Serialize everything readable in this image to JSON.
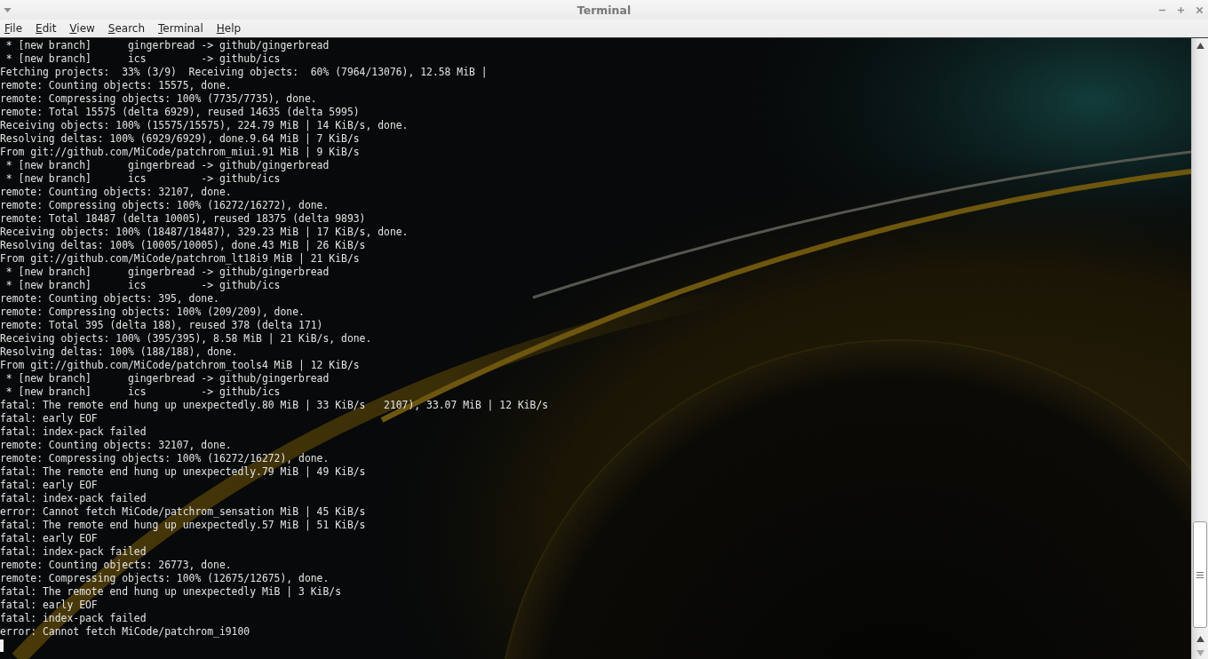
{
  "window": {
    "title": "Terminal"
  },
  "menu_bar": [
    "File",
    "Edit",
    "View",
    "Search",
    "Terminal",
    "Help"
  ],
  "terminal": {
    "lines": [
      " * [new branch]      gingerbread -> github/gingerbread",
      " * [new branch]      ics         -> github/ics",
      "Fetching projects:  33% (3/9)  Receiving objects:  60% (7964/13076), 12.58 MiB |",
      "remote: Counting objects: 15575, done.",
      "remote: Compressing objects: 100% (7735/7735), done.",
      "remote: Total 15575 (delta 6929), reused 14635 (delta 5995)",
      "Receiving objects: 100% (15575/15575), 224.79 MiB | 14 KiB/s, done.",
      "Resolving deltas: 100% (6929/6929), done.9.64 MiB | 7 KiB/s",
      "From git://github.com/MiCode/patchrom_miui.91 MiB | 9 KiB/s",
      " * [new branch]      gingerbread -> github/gingerbread",
      " * [new branch]      ics         -> github/ics",
      "remote: Counting objects: 32107, done.",
      "remote: Compressing objects: 100% (16272/16272), done.",
      "remote: Total 18487 (delta 10005), reused 18375 (delta 9893)",
      "Receiving objects: 100% (18487/18487), 329.23 MiB | 17 KiB/s, done.",
      "Resolving deltas: 100% (10005/10005), done.43 MiB | 26 KiB/s",
      "From git://github.com/MiCode/patchrom_lt18i9 MiB | 21 KiB/s",
      " * [new branch]      gingerbread -> github/gingerbread",
      " * [new branch]      ics         -> github/ics",
      "remote: Counting objects: 395, done.",
      "remote: Compressing objects: 100% (209/209), done.",
      "remote: Total 395 (delta 188), reused 378 (delta 171)",
      "Receiving objects: 100% (395/395), 8.58 MiB | 21 KiB/s, done.",
      "Resolving deltas: 100% (188/188), done.",
      "From git://github.com/MiCode/patchrom_tools4 MiB | 12 KiB/s",
      " * [new branch]      gingerbread -> github/gingerbread",
      " * [new branch]      ics         -> github/ics",
      "fatal: The remote end hung up unexpectedly.80 MiB | 33 KiB/s   2107), 33.07 MiB | 12 KiB/s",
      "fatal: early EOF",
      "fatal: index-pack failed",
      "remote: Counting objects: 32107, done.",
      "remote: Compressing objects: 100% (16272/16272), done.",
      "fatal: The remote end hung up unexpectedly.79 MiB | 49 KiB/s",
      "fatal: early EOF",
      "fatal: index-pack failed",
      "error: Cannot fetch MiCode/patchrom_sensation MiB | 45 KiB/s",
      "fatal: The remote end hung up unexpectedly.57 MiB | 51 KiB/s",
      "fatal: early EOF",
      "fatal: index-pack failed",
      "remote: Counting objects: 26773, done.",
      "remote: Compressing objects: 100% (12675/12675), done.",
      "fatal: The remote end hung up unexpectedly MiB | 3 KiB/s",
      "fatal: early EOF",
      "fatal: index-pack failed",
      "error: Cannot fetch MiCode/patchrom_i9100"
    ]
  }
}
